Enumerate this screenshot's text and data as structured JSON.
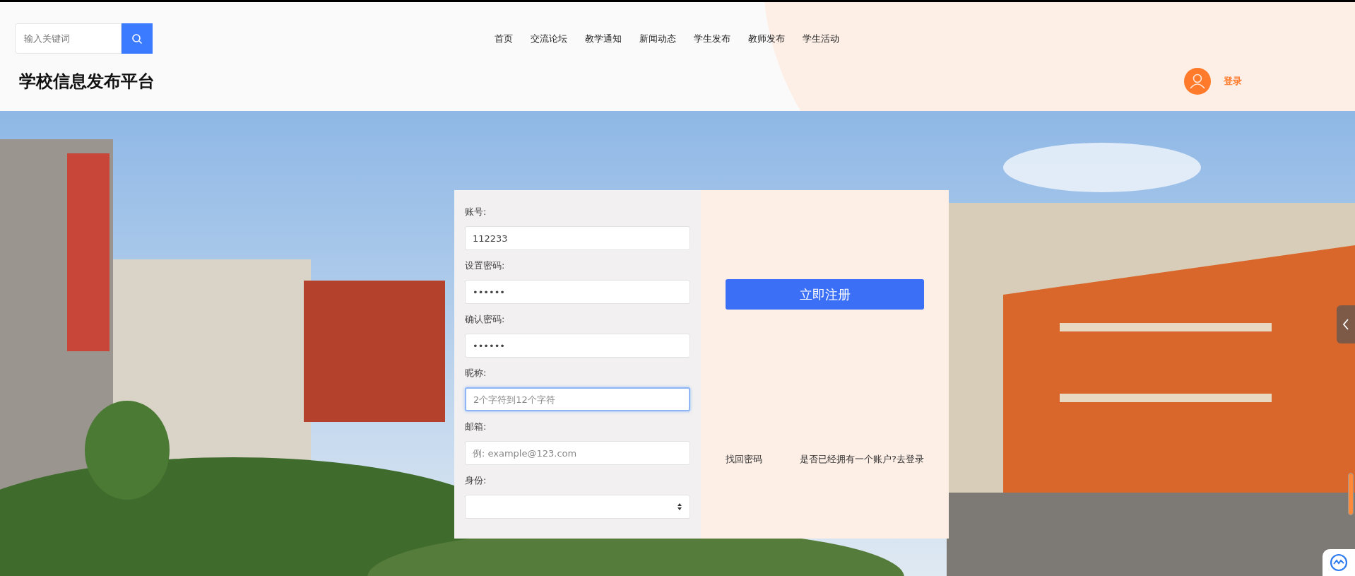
{
  "search": {
    "placeholder": "输入关键词"
  },
  "nav": [
    {
      "label": "首页"
    },
    {
      "label": "交流论坛"
    },
    {
      "label": "教学通知"
    },
    {
      "label": "新闻动态"
    },
    {
      "label": "学生发布"
    },
    {
      "label": "教师发布"
    },
    {
      "label": "学生活动"
    }
  ],
  "site_title": "学校信息发布平台",
  "login_link": "登录",
  "form": {
    "fields": [
      {
        "label": "账号:",
        "kind": "text",
        "value": "112233",
        "focused": false
      },
      {
        "label": "设置密码:",
        "kind": "text",
        "value": "••••••",
        "focused": false
      },
      {
        "label": "确认密码:",
        "kind": "text",
        "value": "••••••",
        "focused": false
      },
      {
        "label": "昵称:",
        "kind": "text",
        "placeholder": "2个字符到12个字符",
        "focused": true
      },
      {
        "label": "邮箱:",
        "kind": "text",
        "placeholder": "例: example@123.com",
        "focused": false
      },
      {
        "label": "身份:",
        "kind": "select",
        "focused": false
      }
    ],
    "submit": "立即注册",
    "links": [
      "找回密码",
      "是否已经拥有一个账户?去登录"
    ]
  }
}
